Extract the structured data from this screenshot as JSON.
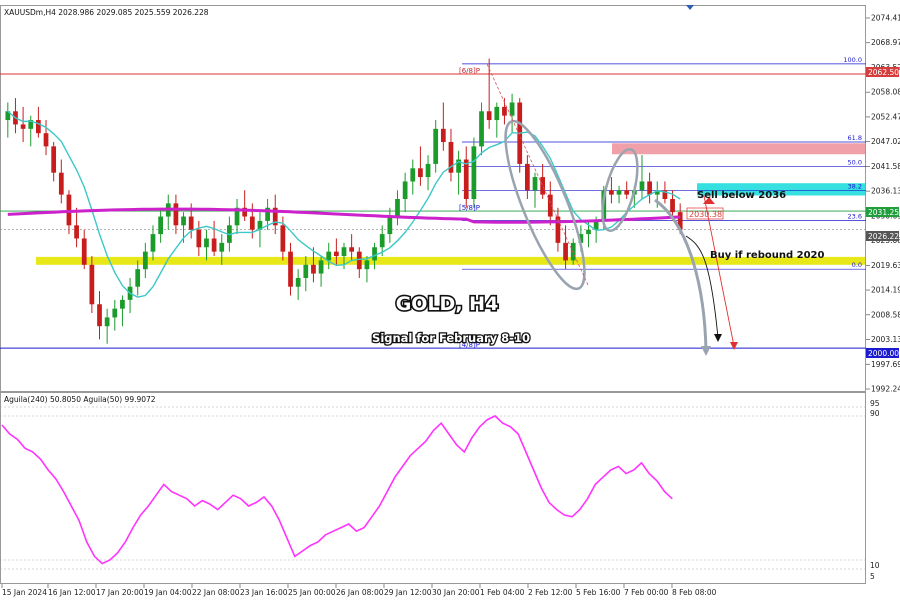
{
  "header": {
    "symbol_line": "XAUUSDm,H4  2028.986 2029.085 2025.559 2026.228",
    "osc_line": "Aguila(240) 50.8050  Aguila(50) 99.9072"
  },
  "price_axis": {
    "ticks": [
      "2074.415",
      "2068.970",
      "2063.525",
      "2058.080",
      "2052.470",
      "2047.025",
      "2041.580",
      "2036.135",
      "2030.690",
      "2025.080",
      "2019.635",
      "2014.190",
      "2008.580",
      "2003.135",
      "1997.690",
      "1992.245"
    ],
    "badges": [
      {
        "text": "2062.500",
        "color": "#d63c3c"
      },
      {
        "text": "2031.250",
        "color": "#1f9e3c"
      },
      {
        "text": "2026.228",
        "color": "#555555"
      },
      {
        "text": "2000.000",
        "color": "#1a1ad0"
      }
    ]
  },
  "osc_axis": {
    "ticks": [
      "95",
      "90",
      "10",
      "5"
    ]
  },
  "time_axis": [
    "15 Jan 2024",
    "16 Jan 12:00",
    "17 Jan 20:00",
    "19 Jan 04:00",
    "22 Jan 08:00",
    "23 Jan 16:00",
    "25 Jan 00:00",
    "26 Jan 08:00",
    "29 Jan 12:00",
    "30 Jan 20:00",
    "1 Feb 04:00",
    "2 Feb 12:00",
    "5 Feb 16:00",
    "7 Feb 00:00",
    "8 Feb 08:00"
  ],
  "annotations": {
    "title": "GOLD, H4",
    "subtitle": "Signal for February 8-10",
    "sell": "Sell below 2036",
    "buy": "Buy if rebound 2020",
    "current_label": "2030.38"
  },
  "fib_levels": [
    {
      "label": "100.0",
      "price": 2064.8
    },
    {
      "label": "61.8",
      "price": 2047.0
    },
    {
      "label": "50.0",
      "price": 2041.4
    },
    {
      "label": "38.2",
      "price": 2035.9
    },
    {
      "label": "23.6",
      "price": 2029.1
    },
    {
      "label": "0.0",
      "price": 2018.0
    }
  ],
  "murrey_levels": [
    {
      "label": "[6/8]P",
      "price": 2062.5
    },
    {
      "label": "[5/8]P",
      "price": 2031.25
    },
    {
      "label": "[4/8]P",
      "price": 2000.0
    }
  ],
  "zones": {
    "sell_zone": [
      2034.8,
      2037.6
    ],
    "pink_zone": [
      2044.2,
      2046.7
    ],
    "yellow_zone": [
      2019.0,
      2020.8
    ]
  },
  "colors": {
    "bull": "#1b9b2a",
    "bear": "#c81d1d",
    "ma_slow": "#cc22cc",
    "ma_fast": "#3cc8c8",
    "osc": "#ff33ff",
    "sell_zone": "#36e0e0",
    "yellow": "#e6e600",
    "pink": "#f0a0a8",
    "fib": "#1a1ad0",
    "murrey_red": "#e03030",
    "murrey_blue": "#1a1ad0"
  },
  "chart_data": {
    "type": "candlestick",
    "ylim": [
      1990.0,
      2078.0
    ],
    "candles": [
      [
        2052,
        2056,
        2048,
        2054
      ],
      [
        2054,
        2057,
        2049,
        2051
      ],
      [
        2051,
        2055,
        2047,
        2050
      ],
      [
        2050,
        2053,
        2046,
        2052
      ],
      [
        2052,
        2055,
        2048,
        2049
      ],
      [
        2049,
        2052,
        2044,
        2046
      ],
      [
        2046,
        2047,
        2038,
        2040
      ],
      [
        2040,
        2043,
        2033,
        2035
      ],
      [
        2035,
        2036,
        2026,
        2028
      ],
      [
        2028,
        2032,
        2023,
        2025
      ],
      [
        2025,
        2027,
        2018,
        2019
      ],
      [
        2019,
        2021,
        2008,
        2010
      ],
      [
        2010,
        2013,
        2002,
        2005
      ],
      [
        2005,
        2009,
        2001,
        2007
      ],
      [
        2007,
        2011,
        2004,
        2009
      ],
      [
        2009,
        2012,
        2005,
        2011
      ],
      [
        2011,
        2016,
        2008,
        2014
      ],
      [
        2014,
        2020,
        2012,
        2018
      ],
      [
        2018,
        2024,
        2016,
        2022
      ],
      [
        2022,
        2028,
        2020,
        2026
      ],
      [
        2026,
        2032,
        2024,
        2030
      ],
      [
        2030,
        2035,
        2027,
        2033
      ],
      [
        2033,
        2035,
        2026,
        2028
      ],
      [
        2028,
        2031,
        2024,
        2030
      ],
      [
        2030,
        2033,
        2025,
        2027
      ],
      [
        2027,
        2029,
        2021,
        2023
      ],
      [
        2023,
        2027,
        2020,
        2025
      ],
      [
        2025,
        2029,
        2021,
        2022
      ],
      [
        2022,
        2026,
        2019,
        2024
      ],
      [
        2024,
        2030,
        2022,
        2028
      ],
      [
        2028,
        2034,
        2026,
        2032
      ],
      [
        2032,
        2036,
        2029,
        2030
      ],
      [
        2030,
        2033,
        2025,
        2027
      ],
      [
        2027,
        2031,
        2023,
        2029
      ],
      [
        2029,
        2034,
        2027,
        2032
      ],
      [
        2032,
        2035,
        2026,
        2028
      ],
      [
        2028,
        2030,
        2020,
        2022
      ],
      [
        2022,
        2024,
        2012,
        2014
      ],
      [
        2014,
        2018,
        2011,
        2016
      ],
      [
        2016,
        2021,
        2013,
        2019
      ],
      [
        2019,
        2023,
        2015,
        2017
      ],
      [
        2017,
        2021,
        2014,
        2020
      ],
      [
        2020,
        2024,
        2018,
        2022
      ],
      [
        2022,
        2025,
        2019,
        2021
      ],
      [
        2021,
        2024,
        2018,
        2023
      ],
      [
        2023,
        2026,
        2020,
        2022
      ],
      [
        2022,
        2023,
        2016,
        2018
      ],
      [
        2018,
        2021,
        2015,
        2020
      ],
      [
        2020,
        2024,
        2018,
        2023
      ],
      [
        2023,
        2028,
        2021,
        2026
      ],
      [
        2026,
        2032,
        2024,
        2030
      ],
      [
        2030,
        2036,
        2028,
        2034
      ],
      [
        2034,
        2040,
        2031,
        2038
      ],
      [
        2038,
        2043,
        2035,
        2041
      ],
      [
        2041,
        2046,
        2037,
        2039
      ],
      [
        2039,
        2044,
        2036,
        2042
      ],
      [
        2042,
        2052,
        2040,
        2050
      ],
      [
        2050,
        2056,
        2045,
        2047
      ],
      [
        2047,
        2050,
        2038,
        2040
      ],
      [
        2040,
        2045,
        2035,
        2043
      ],
      [
        2043,
        2046,
        2032,
        2034
      ],
      [
        2034,
        2048,
        2032,
        2046
      ],
      [
        2046,
        2056,
        2044,
        2054
      ],
      [
        2054,
        2066,
        2050,
        2052
      ],
      [
        2052,
        2056,
        2048,
        2055
      ],
      [
        2055,
        2057,
        2051,
        2053
      ],
      [
        2053,
        2058,
        2049,
        2056
      ],
      [
        2056,
        2057,
        2040,
        2042
      ],
      [
        2042,
        2044,
        2034,
        2036
      ],
      [
        2036,
        2040,
        2032,
        2039
      ],
      [
        2039,
        2042,
        2034,
        2035
      ],
      [
        2035,
        2038,
        2028,
        2030
      ],
      [
        2030,
        2032,
        2022,
        2024
      ],
      [
        2024,
        2028,
        2018,
        2020
      ],
      [
        2020,
        2025,
        2019,
        2024
      ],
      [
        2024,
        2028,
        2022,
        2026
      ],
      [
        2026,
        2029,
        2023,
        2027
      ],
      [
        2027,
        2030,
        2024,
        2029
      ],
      [
        2029,
        2037,
        2027,
        2036
      ],
      [
        2036,
        2039,
        2033,
        2035
      ],
      [
        2035,
        2037,
        2033,
        2036
      ],
      [
        2036,
        2038,
        2034,
        2035
      ],
      [
        2035,
        2037,
        2032,
        2036
      ],
      [
        2036,
        2044,
        2034,
        2038
      ],
      [
        2038,
        2040,
        2033,
        2035
      ],
      [
        2035,
        2038,
        2032,
        2036
      ],
      [
        2036,
        2038,
        2033,
        2034
      ],
      [
        2034,
        2036,
        2029,
        2031
      ],
      [
        2031,
        2033,
        2026,
        2027
      ]
    ],
    "aguila_240": [
      85,
      80,
      77,
      72,
      70,
      66,
      60,
      55,
      48,
      40,
      32,
      20,
      12,
      8,
      10,
      14,
      20,
      28,
      35,
      40,
      46,
      52,
      48,
      46,
      44,
      40,
      43,
      41,
      38,
      42,
      46,
      44,
      40,
      42,
      45,
      40,
      32,
      22,
      12,
      15,
      18,
      20,
      24,
      26,
      28,
      30,
      26,
      28,
      34,
      40,
      48,
      56,
      62,
      68,
      72,
      76,
      82,
      86,
      80,
      74,
      70,
      78,
      84,
      88,
      90,
      86,
      84,
      80,
      70,
      60,
      50,
      42,
      38,
      35,
      34,
      38,
      44,
      52,
      56,
      60,
      62,
      58,
      60,
      64,
      58,
      54,
      48,
      44
    ],
    "aguila_50_level": 99.9,
    "osc_ylim": [
      0,
      100
    ]
  }
}
